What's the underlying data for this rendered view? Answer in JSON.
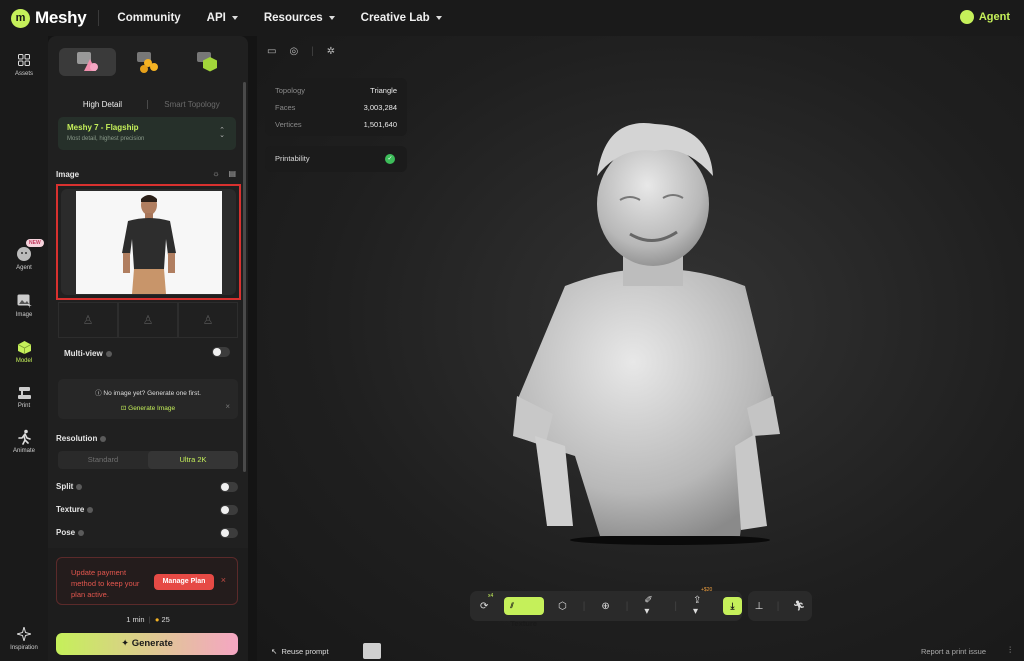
{
  "brand": {
    "name": "Meshy"
  },
  "nav": [
    {
      "label": "Community",
      "caret": false
    },
    {
      "label": "API",
      "caret": true
    },
    {
      "label": "Resources",
      "caret": true
    },
    {
      "label": "Creative Lab",
      "caret": true
    }
  ],
  "agent_top": "Agent",
  "rail": {
    "assets": "Assets",
    "agent": "Agent",
    "agent_badge": "NEW",
    "image": "Image",
    "model": "Model",
    "print": "Print",
    "animate": "Animate",
    "inspiration": "Inspiration"
  },
  "panel": {
    "mode_high": "High Detail",
    "mode_smart": "Smart Topology",
    "model_name": "Meshy 7 - Flagship",
    "model_desc": "Most detail, highest precision",
    "image_label": "Image",
    "multiview_label": "Multi-view",
    "no_image_text": "No image yet? Generate one first.",
    "generate_image": "Generate Image",
    "resolution_label": "Resolution",
    "res_standard": "Standard",
    "res_ultra": "Ultra 2K",
    "split_label": "Split",
    "texture_label": "Texture",
    "pose_label": "Pose"
  },
  "payment": {
    "message": "Update payment method to keep your plan active.",
    "button": "Manage Plan"
  },
  "meta": {
    "time": "1 min",
    "credits": "25"
  },
  "generate_label": "Generate",
  "stats": {
    "topology_label": "Topology",
    "topology_value": "Triangle",
    "faces_label": "Faces",
    "faces_value": "3,003,284",
    "vertices_label": "Vertices",
    "vertices_value": "1,501,640"
  },
  "printability_label": "Printability",
  "toolbar": {
    "retry_sup": "x4",
    "texture_label": "Texture",
    "export_sup": "+$20"
  },
  "footer": {
    "reuse_prompt": "Reuse prompt",
    "report": "Report a print issue"
  },
  "colors": {
    "accent": "#c5f05a",
    "danger": "#e64a45",
    "highlight_border": "#d9312f"
  }
}
